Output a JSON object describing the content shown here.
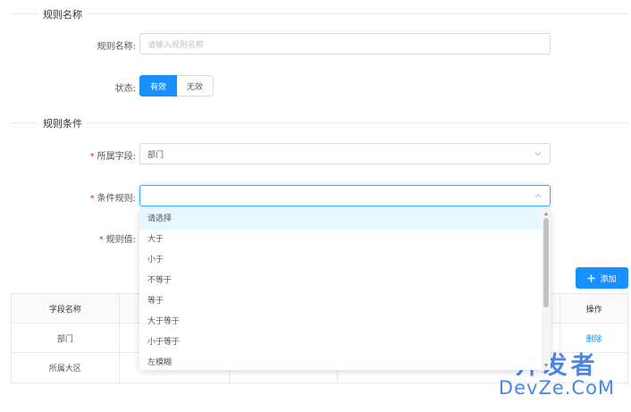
{
  "sections": {
    "rule_name": "规则名称",
    "rule_conditions": "规则条件"
  },
  "form": {
    "rule_name_label": "规则名称:",
    "rule_name_placeholder": "请输入规则名称",
    "status_label": "状态:",
    "status_options": [
      "有效",
      "无效"
    ],
    "status_selected": "有效",
    "field_label": "所属字段:",
    "field_value": "部门",
    "condition_label": "条件规则:",
    "condition_value": "",
    "rule_value_label": "规则值:"
  },
  "dropdown": {
    "items": [
      "请选择",
      "大于",
      "小于",
      "不等于",
      "等于",
      "大于等于",
      "小于等于",
      "左模糊"
    ]
  },
  "toolbar": {
    "add_label": "添加"
  },
  "table": {
    "headers": [
      "字段名称",
      "",
      "",
      "",
      "操作"
    ],
    "rows": [
      [
        "部门",
        "",
        "",
        "",
        "删除"
      ],
      [
        "所属大区",
        "",
        "",
        "",
        ""
      ]
    ]
  },
  "watermark": {
    "top": "开发者",
    "bottom": "DevZe.CoM"
  },
  "colors": {
    "primary": "#1890ff",
    "required": "#f5222d",
    "border": "#d9d9d9",
    "hover": "#e6f7ff"
  }
}
